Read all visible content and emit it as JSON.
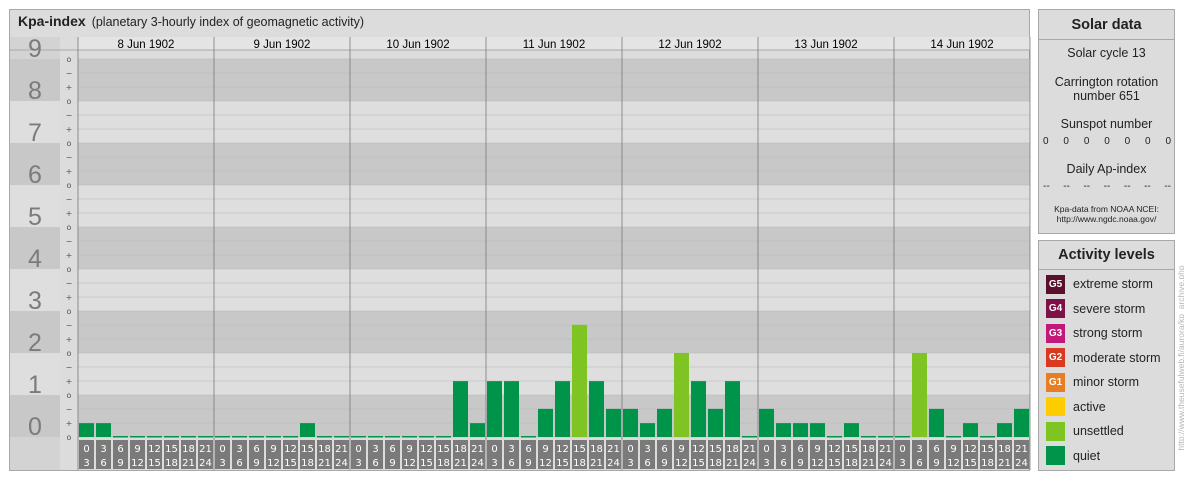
{
  "header": {
    "title": "Kpa-index",
    "subtitle": "(planetary 3-hourly index of geomagnetic activity)"
  },
  "chart_data": {
    "type": "bar",
    "title": "Kpa-index",
    "subtitle": "(planetary 3-hourly index of geomagnetic activity)",
    "ylim": [
      0,
      9
    ],
    "y_ticks": [
      "0",
      "1",
      "2",
      "3",
      "4",
      "5",
      "6",
      "7",
      "8",
      "9"
    ],
    "sub_ticks": [
      "o",
      "+",
      "−"
    ],
    "days": [
      "8 Jun 1902",
      "9 Jun 1902",
      "10 Jun 1902",
      "11 Jun 1902",
      "12 Jun 1902",
      "13 Jun 1902",
      "14 Jun 1902"
    ],
    "interval_start_labels": [
      "0",
      "3",
      "6",
      "9",
      "12",
      "15",
      "18",
      "21"
    ],
    "interval_end_labels": [
      "3",
      "6",
      "9",
      "12",
      "15",
      "18",
      "21",
      "24"
    ],
    "values": [
      [
        0.33,
        0.33,
        0,
        0,
        0,
        0,
        0,
        0
      ],
      [
        0,
        0,
        0,
        0,
        0,
        0.33,
        0,
        0
      ],
      [
        0,
        0,
        0,
        0,
        0,
        0,
        1.33,
        0.33
      ],
      [
        1.33,
        1.33,
        0,
        0.67,
        1.33,
        2.67,
        1.33,
        0.67
      ],
      [
        0.67,
        0.33,
        0.67,
        2,
        1.33,
        0.67,
        1.33,
        0
      ],
      [
        0.67,
        0.33,
        0.33,
        0.33,
        0,
        0.33,
        0,
        0
      ],
      [
        0,
        2,
        0.67,
        0,
        0.33,
        0,
        0.33,
        0.67
      ]
    ],
    "level_colors": {
      "quiet": "#00934a",
      "unsettled": "#7ec423",
      "active": "#ffcc00"
    },
    "grid": true
  },
  "solar": {
    "title": "Solar data",
    "cycle": "Solar cycle 13",
    "carrington_line1": "Carrington rotation",
    "carrington_line2": "number 651",
    "sunspot_label": "Sunspot number",
    "sunspot_values": [
      "0",
      "0",
      "0",
      "0",
      "0",
      "0",
      "0"
    ],
    "ap_label": "Daily Ap-index",
    "ap_values": [
      "--",
      "--",
      "--",
      "--",
      "--",
      "--",
      "--"
    ],
    "source_line1": "Kpa-data from NOAA NCEI:",
    "source_line2": "http://www.ngdc.noaa.gov/"
  },
  "activity": {
    "title": "Activity levels",
    "items": [
      {
        "code": "G5",
        "label": "extreme storm",
        "color": "#5a0f2d"
      },
      {
        "code": "G4",
        "label": "severe storm",
        "color": "#7d1148"
      },
      {
        "code": "G3",
        "label": "strong storm",
        "color": "#c3177a"
      },
      {
        "code": "G2",
        "label": "moderate storm",
        "color": "#d9391f"
      },
      {
        "code": "G1",
        "label": "minor storm",
        "color": "#e77e23"
      },
      {
        "code": "",
        "label": "active",
        "color": "#ffcc00"
      },
      {
        "code": "",
        "label": "unsettled",
        "color": "#7ec423"
      },
      {
        "code": "",
        "label": "quiet",
        "color": "#00934a"
      }
    ]
  },
  "watermark": "http://www.theusefulweb.fi/aurora/kp_archive.php"
}
